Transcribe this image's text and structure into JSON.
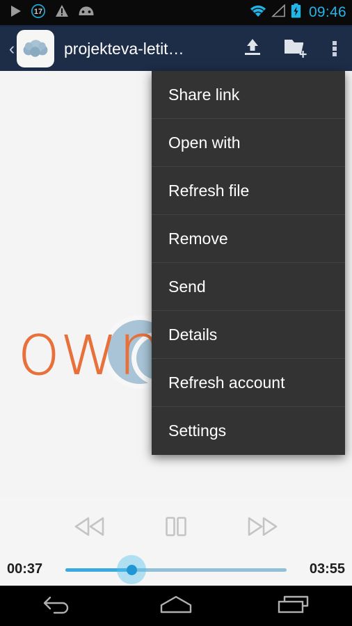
{
  "status_bar": {
    "notification_count": "17",
    "clock": "09:46",
    "icons_left": [
      "play-icon",
      "notification-count-icon",
      "warning-icon",
      "android-head-icon"
    ],
    "icons_right": [
      "wifi-icon",
      "signal-icon",
      "battery-charging-icon"
    ],
    "accent_color": "#22b5e8",
    "background": "#0a0a0a"
  },
  "action_bar": {
    "background": "#1d2c47",
    "back_label": "‹",
    "app_icon": "owncloud-logo-icon",
    "title": "projekteva-letit…",
    "actions": [
      {
        "name": "upload-button",
        "icon": "upload-icon"
      },
      {
        "name": "new-folder-button",
        "icon": "new-folder-icon"
      },
      {
        "name": "overflow-button",
        "icon": "overflow-menu-icon"
      }
    ]
  },
  "splash": {
    "wordmark": "own",
    "wordmark_color": "#e8703a",
    "cloud_color": "#a8c4d6",
    "background": "#f4f4f4"
  },
  "overflow_menu": {
    "background": "#333333",
    "items": [
      {
        "label": "Share link"
      },
      {
        "label": "Open with"
      },
      {
        "label": "Refresh file"
      },
      {
        "label": "Remove"
      },
      {
        "label": "Send"
      },
      {
        "label": "Details"
      },
      {
        "label": "Refresh account"
      },
      {
        "label": "Settings"
      }
    ]
  },
  "media_player": {
    "rewind_icon": "rewind-icon",
    "pause_icon": "pause-icon",
    "forward_icon": "fast-forward-icon",
    "current_time": "00:37",
    "total_time": "03:55",
    "progress_percent": 30,
    "track_color": "#8fc0d8",
    "progress_color": "#3aa9dd",
    "thumb_color": "#2196d4"
  },
  "nav_bar": {
    "background": "#000000",
    "buttons": [
      {
        "name": "nav-back-button",
        "icon": "back-arrow-icon"
      },
      {
        "name": "nav-home-button",
        "icon": "home-icon"
      },
      {
        "name": "nav-recents-button",
        "icon": "recents-icon"
      }
    ]
  }
}
